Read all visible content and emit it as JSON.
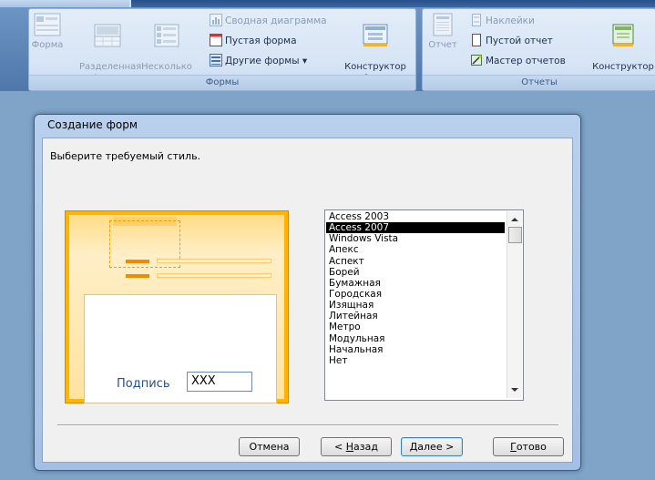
{
  "ribbon": {
    "forms_group": {
      "label": "Формы",
      "form": "Форма",
      "split_form": "Разделенная\nформа",
      "multi_items": "Несколько\nэлементов",
      "pivot_chart": "Сводная диаграмма",
      "blank_form": "Пустая форма",
      "more_forms": "Другие формы ▾",
      "form_design": "Конструктор\nформ"
    },
    "reports_group": {
      "label": "Отчеты",
      "report": "Отчет",
      "labels": "Наклейки",
      "blank_report": "Пустой отчет",
      "report_wizard": "Мастер отчетов",
      "report_design": "Конструктор\nотчетов"
    }
  },
  "dialog": {
    "title": "Создание форм",
    "prompt": "Выберите требуемый стиль.",
    "preview": {
      "caption": "Подпись",
      "value": "XXX"
    },
    "styles": [
      "Access 2003",
      "Access 2007",
      "Windows Vista",
      "Апекс",
      "Аспект",
      "Борей",
      "Бумажная",
      "Городская",
      "Изящная",
      "Литейная",
      "Метро",
      "Модульная",
      "Начальная",
      "Нет"
    ],
    "selected_style": "Access 2007",
    "buttons": {
      "cancel": "Отмена",
      "back_prefix": "< ",
      "back_key": "Н",
      "back_rest": "азад",
      "next_key": "Д",
      "next_rest": "алее >",
      "finish_key": "Г",
      "finish_rest": "отово"
    }
  }
}
